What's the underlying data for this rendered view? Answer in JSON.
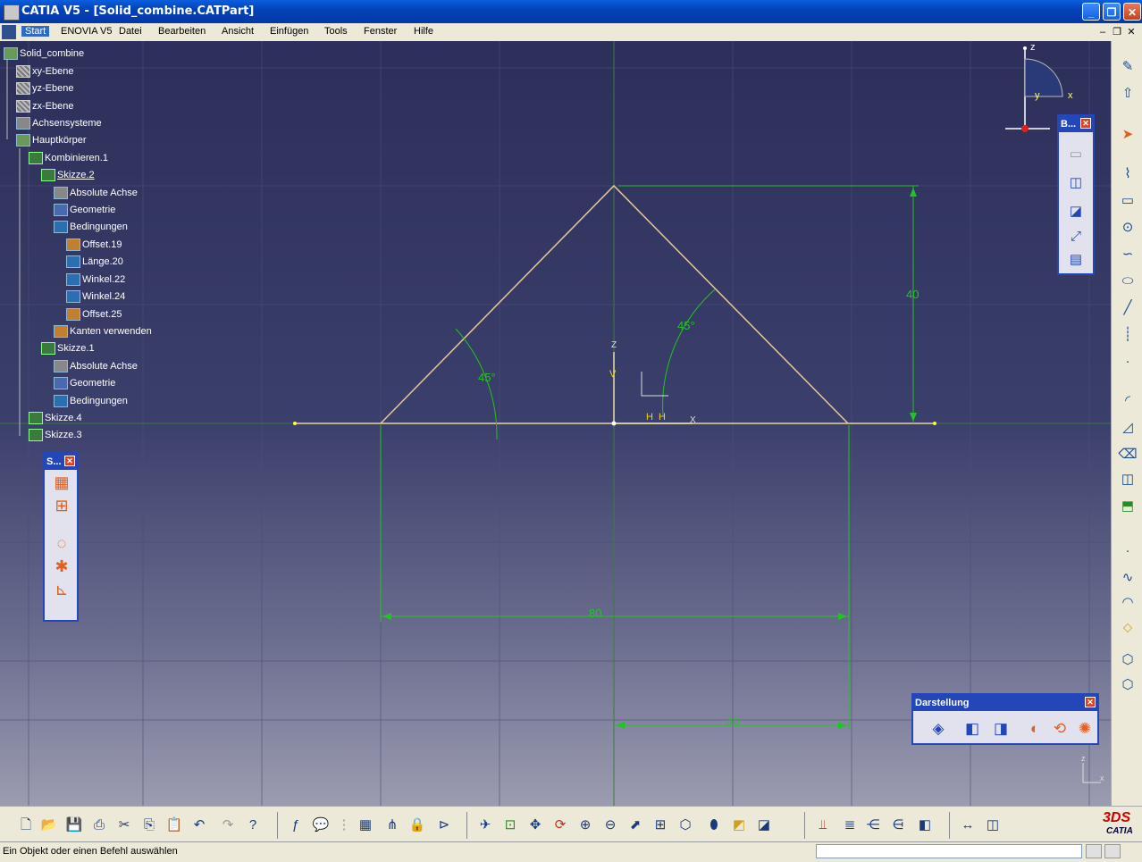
{
  "window": {
    "title": "CATIA V5 - [Solid_combine.CATPart]"
  },
  "menu": {
    "items": [
      "Start",
      "ENOVIA V5",
      "Datei",
      "Bearbeiten",
      "Ansicht",
      "Einfügen",
      "Tools",
      "Fenster",
      "Hilfe"
    ]
  },
  "tree": {
    "nodes": [
      {
        "label": "Solid_combine",
        "icon": "part-icon"
      },
      {
        "label": "xy-Ebene",
        "icon": "plane-icon"
      },
      {
        "label": "yz-Ebene",
        "icon": "plane-icon"
      },
      {
        "label": "zx-Ebene",
        "icon": "plane-icon"
      },
      {
        "label": "Achsensysteme",
        "icon": "axis-system-icon"
      },
      {
        "label": "Hauptkörper",
        "icon": "body-icon"
      },
      {
        "label": "Kombinieren.1",
        "icon": "combine-icon"
      },
      {
        "label": "Skizze.2",
        "icon": "sketch-icon"
      },
      {
        "label": "Absolute Achse",
        "icon": "absolute-axis-icon"
      },
      {
        "label": "Geometrie",
        "icon": "geometry-icon"
      },
      {
        "label": "Bedingungen",
        "icon": "constraints-icon"
      },
      {
        "label": "Offset.19",
        "icon": "offset-icon"
      },
      {
        "label": "Länge.20",
        "icon": "length-icon"
      },
      {
        "label": "Winkel.22",
        "icon": "angle-icon"
      },
      {
        "label": "Winkel.24",
        "icon": "angle-icon"
      },
      {
        "label": "Offset.25",
        "icon": "offset-icon"
      },
      {
        "label": "Kanten verwenden",
        "icon": "use-edges-icon"
      },
      {
        "label": "Skizze.1",
        "icon": "sketch-icon"
      },
      {
        "label": "Absolute Achse",
        "icon": "absolute-axis-icon"
      },
      {
        "label": "Geometrie",
        "icon": "geometry-icon"
      },
      {
        "label": "Bedingungen",
        "icon": "constraints-icon"
      },
      {
        "label": "Skizze.4",
        "icon": "sketch-icon"
      },
      {
        "label": "Skizze.3",
        "icon": "sketch-icon"
      }
    ]
  },
  "sketch": {
    "angle_left": "45°",
    "angle_right": "45°",
    "height_dim": "40",
    "width_dim": "80",
    "half_dim": "40",
    "h_axis": "H",
    "v_axis": "V",
    "z_axis": "Z",
    "x_axis": "X"
  },
  "compass": {
    "z": "z",
    "x": "x",
    "y": "y"
  },
  "mini_axis": {
    "z": "z",
    "x": "x"
  },
  "toolbars": {
    "sketch_tools": {
      "title": "S..."
    },
    "b_toolbar": {
      "title": "B..."
    },
    "darstellung": {
      "title": "Darstellung"
    }
  },
  "status": {
    "message": "Ein Objekt oder einen Befehl auswählen"
  },
  "logo": {
    "mark": "3DS",
    "name": "CATIA"
  },
  "colors": {
    "sketch_geometry": "#e8c89a",
    "dimension": "#22c422",
    "title_blue": "#0442b8",
    "toolbar_border": "#2346b8"
  }
}
